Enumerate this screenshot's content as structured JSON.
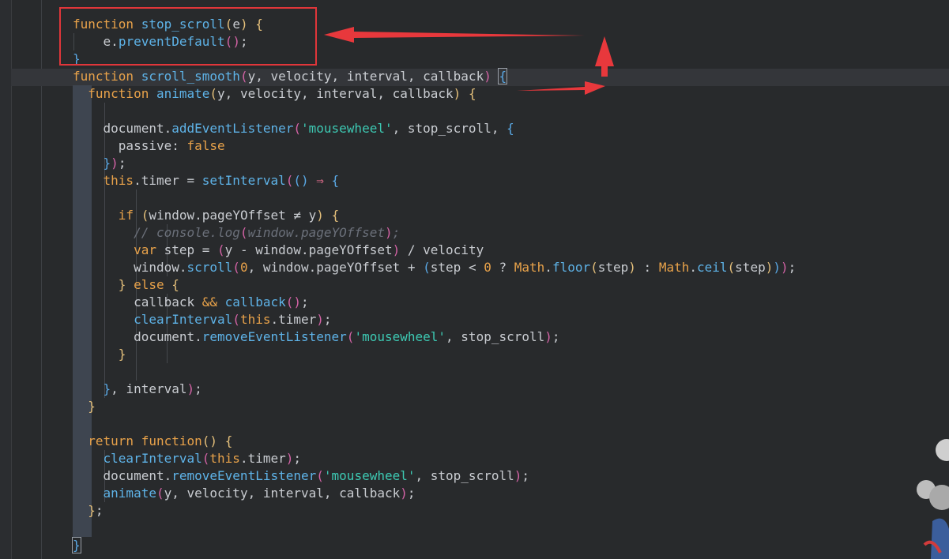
{
  "editor": {
    "language": "javascript",
    "code_lines": [
      [
        {
          "t": "    ",
          "c": ""
        },
        {
          "t": "function",
          "c": "kw"
        },
        {
          "t": " ",
          "c": ""
        },
        {
          "t": "stop_scroll",
          "c": "fn"
        },
        {
          "t": "(",
          "c": "p1"
        },
        {
          "t": "e",
          "c": "id"
        },
        {
          "t": ")",
          "c": "p1"
        },
        {
          "t": " ",
          "c": ""
        },
        {
          "t": "{",
          "c": "p1"
        }
      ],
      [
        {
          "t": "        ",
          "c": ""
        },
        {
          "t": "e",
          "c": "id"
        },
        {
          "t": ".",
          "c": "op"
        },
        {
          "t": "preventDefault",
          "c": "fn"
        },
        {
          "t": "(",
          "c": "p2"
        },
        {
          "t": ")",
          "c": "p2"
        },
        {
          "t": ";",
          "c": "op"
        }
      ],
      [
        {
          "t": "    ",
          "c": ""
        },
        {
          "t": "}",
          "c": "p3"
        }
      ],
      [
        {
          "t": "    ",
          "c": ""
        },
        {
          "t": "function",
          "c": "kw"
        },
        {
          "t": " ",
          "c": ""
        },
        {
          "t": "scroll_smooth",
          "c": "fn"
        },
        {
          "t": "(",
          "c": "p2"
        },
        {
          "t": "y, velocity, interval, callback",
          "c": "id"
        },
        {
          "t": ")",
          "c": "p2"
        },
        {
          "t": " ",
          "c": ""
        },
        {
          "t": "{",
          "c": "p3 cursor-box"
        }
      ],
      [
        {
          "t": "      ",
          "c": ""
        },
        {
          "t": "function",
          "c": "kw"
        },
        {
          "t": " ",
          "c": ""
        },
        {
          "t": "animate",
          "c": "fn"
        },
        {
          "t": "(",
          "c": "p1"
        },
        {
          "t": "y, velocity, interval, callback",
          "c": "id"
        },
        {
          "t": ")",
          "c": "p1"
        },
        {
          "t": " ",
          "c": ""
        },
        {
          "t": "{",
          "c": "p1"
        }
      ],
      [
        {
          "t": "",
          "c": ""
        }
      ],
      [
        {
          "t": "        ",
          "c": ""
        },
        {
          "t": "document",
          "c": "id"
        },
        {
          "t": ".",
          "c": "op"
        },
        {
          "t": "addEventListener",
          "c": "fn"
        },
        {
          "t": "(",
          "c": "p2"
        },
        {
          "t": "'mousewheel'",
          "c": "str"
        },
        {
          "t": ", stop_scroll, ",
          "c": "id"
        },
        {
          "t": "{",
          "c": "p3"
        }
      ],
      [
        {
          "t": "          ",
          "c": ""
        },
        {
          "t": "passive",
          "c": "id"
        },
        {
          "t": ": ",
          "c": "op"
        },
        {
          "t": "false",
          "c": "kw2"
        }
      ],
      [
        {
          "t": "        ",
          "c": ""
        },
        {
          "t": "}",
          "c": "p3"
        },
        {
          "t": ")",
          "c": "p2"
        },
        {
          "t": ";",
          "c": "op"
        }
      ],
      [
        {
          "t": "        ",
          "c": ""
        },
        {
          "t": "this",
          "c": "this"
        },
        {
          "t": ".timer = ",
          "c": "id"
        },
        {
          "t": "setInterval",
          "c": "fn"
        },
        {
          "t": "(",
          "c": "p2"
        },
        {
          "t": "()",
          "c": "p3"
        },
        {
          "t": " ⇒ ",
          "c": "opk"
        },
        {
          "t": "{",
          "c": "p3"
        }
      ],
      [
        {
          "t": "",
          "c": ""
        }
      ],
      [
        {
          "t": "          ",
          "c": ""
        },
        {
          "t": "if",
          "c": "kw"
        },
        {
          "t": " ",
          "c": ""
        },
        {
          "t": "(",
          "c": "p1"
        },
        {
          "t": "window",
          "c": "id"
        },
        {
          "t": ".",
          "c": "op"
        },
        {
          "t": "pageYOffset",
          "c": "id"
        },
        {
          "t": " ≠ ",
          "c": "op"
        },
        {
          "t": "y",
          "c": "id"
        },
        {
          "t": ")",
          "c": "p1"
        },
        {
          "t": " ",
          "c": ""
        },
        {
          "t": "{",
          "c": "p1"
        }
      ],
      [
        {
          "t": "            ",
          "c": ""
        },
        {
          "t": "// console.log",
          "c": "cmt"
        },
        {
          "t": "(",
          "c": "p2"
        },
        {
          "t": "window.pageYOffset",
          "c": "cmt"
        },
        {
          "t": ")",
          "c": "p2"
        },
        {
          "t": ";",
          "c": "cmt"
        }
      ],
      [
        {
          "t": "            ",
          "c": ""
        },
        {
          "t": "var",
          "c": "kw"
        },
        {
          "t": " step = ",
          "c": "id"
        },
        {
          "t": "(",
          "c": "p2"
        },
        {
          "t": "y - window",
          "c": "id"
        },
        {
          "t": ".",
          "c": "op"
        },
        {
          "t": "pageYOffset",
          "c": "id"
        },
        {
          "t": ")",
          "c": "p2"
        },
        {
          "t": " / velocity",
          "c": "id"
        }
      ],
      [
        {
          "t": "            ",
          "c": ""
        },
        {
          "t": "window",
          "c": "id"
        },
        {
          "t": ".",
          "c": "op"
        },
        {
          "t": "scroll",
          "c": "fn"
        },
        {
          "t": "(",
          "c": "p2"
        },
        {
          "t": "0",
          "c": "num"
        },
        {
          "t": ", window",
          "c": "id"
        },
        {
          "t": ".",
          "c": "op"
        },
        {
          "t": "pageYOffset + ",
          "c": "id"
        },
        {
          "t": "(",
          "c": "p3"
        },
        {
          "t": "step < ",
          "c": "id"
        },
        {
          "t": "0",
          "c": "num"
        },
        {
          "t": " ? ",
          "c": "id"
        },
        {
          "t": "Math",
          "c": "kw2"
        },
        {
          "t": ".",
          "c": "op"
        },
        {
          "t": "floor",
          "c": "fn"
        },
        {
          "t": "(",
          "c": "p1"
        },
        {
          "t": "step",
          "c": "id"
        },
        {
          "t": ")",
          "c": "p1"
        },
        {
          "t": " : ",
          "c": "id"
        },
        {
          "t": "Math",
          "c": "kw2"
        },
        {
          "t": ".",
          "c": "op"
        },
        {
          "t": "ceil",
          "c": "fn"
        },
        {
          "t": "(",
          "c": "p1"
        },
        {
          "t": "step",
          "c": "id"
        },
        {
          "t": ")",
          "c": "p1"
        },
        {
          "t": ")",
          "c": "p3"
        },
        {
          "t": ")",
          "c": "p2"
        },
        {
          "t": ";",
          "c": "op"
        }
      ],
      [
        {
          "t": "          ",
          "c": ""
        },
        {
          "t": "}",
          "c": "p1"
        },
        {
          "t": " ",
          "c": ""
        },
        {
          "t": "else",
          "c": "kw"
        },
        {
          "t": " ",
          "c": ""
        },
        {
          "t": "{",
          "c": "p1"
        }
      ],
      [
        {
          "t": "            ",
          "c": ""
        },
        {
          "t": "callback ",
          "c": "id"
        },
        {
          "t": "&&",
          "c": "kw2"
        },
        {
          "t": " ",
          "c": ""
        },
        {
          "t": "callback",
          "c": "fn"
        },
        {
          "t": "(",
          "c": "p2"
        },
        {
          "t": ")",
          "c": "p2"
        },
        {
          "t": ";",
          "c": "op"
        }
      ],
      [
        {
          "t": "            ",
          "c": ""
        },
        {
          "t": "clearInterval",
          "c": "fn"
        },
        {
          "t": "(",
          "c": "p2"
        },
        {
          "t": "this",
          "c": "this"
        },
        {
          "t": ".timer",
          "c": "id"
        },
        {
          "t": ")",
          "c": "p2"
        },
        {
          "t": ";",
          "c": "op"
        }
      ],
      [
        {
          "t": "            ",
          "c": ""
        },
        {
          "t": "document",
          "c": "id"
        },
        {
          "t": ".",
          "c": "op"
        },
        {
          "t": "removeEventListener",
          "c": "fn"
        },
        {
          "t": "(",
          "c": "p2"
        },
        {
          "t": "'mousewheel'",
          "c": "str"
        },
        {
          "t": ", stop_scroll",
          "c": "id"
        },
        {
          "t": ")",
          "c": "p2"
        },
        {
          "t": ";",
          "c": "op"
        }
      ],
      [
        {
          "t": "          ",
          "c": ""
        },
        {
          "t": "}",
          "c": "p1"
        }
      ],
      [
        {
          "t": "",
          "c": ""
        }
      ],
      [
        {
          "t": "        ",
          "c": ""
        },
        {
          "t": "}",
          "c": "p3"
        },
        {
          "t": ", interval",
          "c": "id"
        },
        {
          "t": ")",
          "c": "p2"
        },
        {
          "t": ";",
          "c": "op"
        }
      ],
      [
        {
          "t": "      ",
          "c": ""
        },
        {
          "t": "}",
          "c": "p1"
        }
      ],
      [
        {
          "t": "",
          "c": ""
        }
      ],
      [
        {
          "t": "      ",
          "c": ""
        },
        {
          "t": "return",
          "c": "kw"
        },
        {
          "t": " ",
          "c": ""
        },
        {
          "t": "function",
          "c": "kw"
        },
        {
          "t": "(",
          "c": "p1"
        },
        {
          "t": ")",
          "c": "p1"
        },
        {
          "t": " ",
          "c": ""
        },
        {
          "t": "{",
          "c": "p1"
        }
      ],
      [
        {
          "t": "        ",
          "c": ""
        },
        {
          "t": "clearInterval",
          "c": "fn"
        },
        {
          "t": "(",
          "c": "p2"
        },
        {
          "t": "this",
          "c": "this"
        },
        {
          "t": ".timer",
          "c": "id"
        },
        {
          "t": ")",
          "c": "p2"
        },
        {
          "t": ";",
          "c": "op"
        }
      ],
      [
        {
          "t": "        ",
          "c": ""
        },
        {
          "t": "document",
          "c": "id"
        },
        {
          "t": ".",
          "c": "op"
        },
        {
          "t": "removeEventListener",
          "c": "fn"
        },
        {
          "t": "(",
          "c": "p2"
        },
        {
          "t": "'mousewheel'",
          "c": "str"
        },
        {
          "t": ", stop_scroll",
          "c": "id"
        },
        {
          "t": ")",
          "c": "p2"
        },
        {
          "t": ";",
          "c": "op"
        }
      ],
      [
        {
          "t": "        ",
          "c": ""
        },
        {
          "t": "animate",
          "c": "fn"
        },
        {
          "t": "(",
          "c": "p2"
        },
        {
          "t": "y, velocity, interval, callback",
          "c": "id"
        },
        {
          "t": ")",
          "c": "p2"
        },
        {
          "t": ";",
          "c": "op"
        }
      ],
      [
        {
          "t": "      ",
          "c": ""
        },
        {
          "t": "}",
          "c": "p1"
        },
        {
          "t": ";",
          "c": "op"
        }
      ],
      [
        {
          "t": "",
          "c": ""
        }
      ],
      [
        {
          "t": "    ",
          "c": ""
        },
        {
          "t": "}",
          "c": "p3 cursor-box"
        }
      ]
    ]
  },
  "annotation": {
    "highlight_color": "#e0363a"
  },
  "colors": {
    "background": "#282a2c",
    "keyword": "#e8a24a",
    "function": "#5eb3e8",
    "string": "#3dc9b3",
    "comment": "#6b707a"
  }
}
